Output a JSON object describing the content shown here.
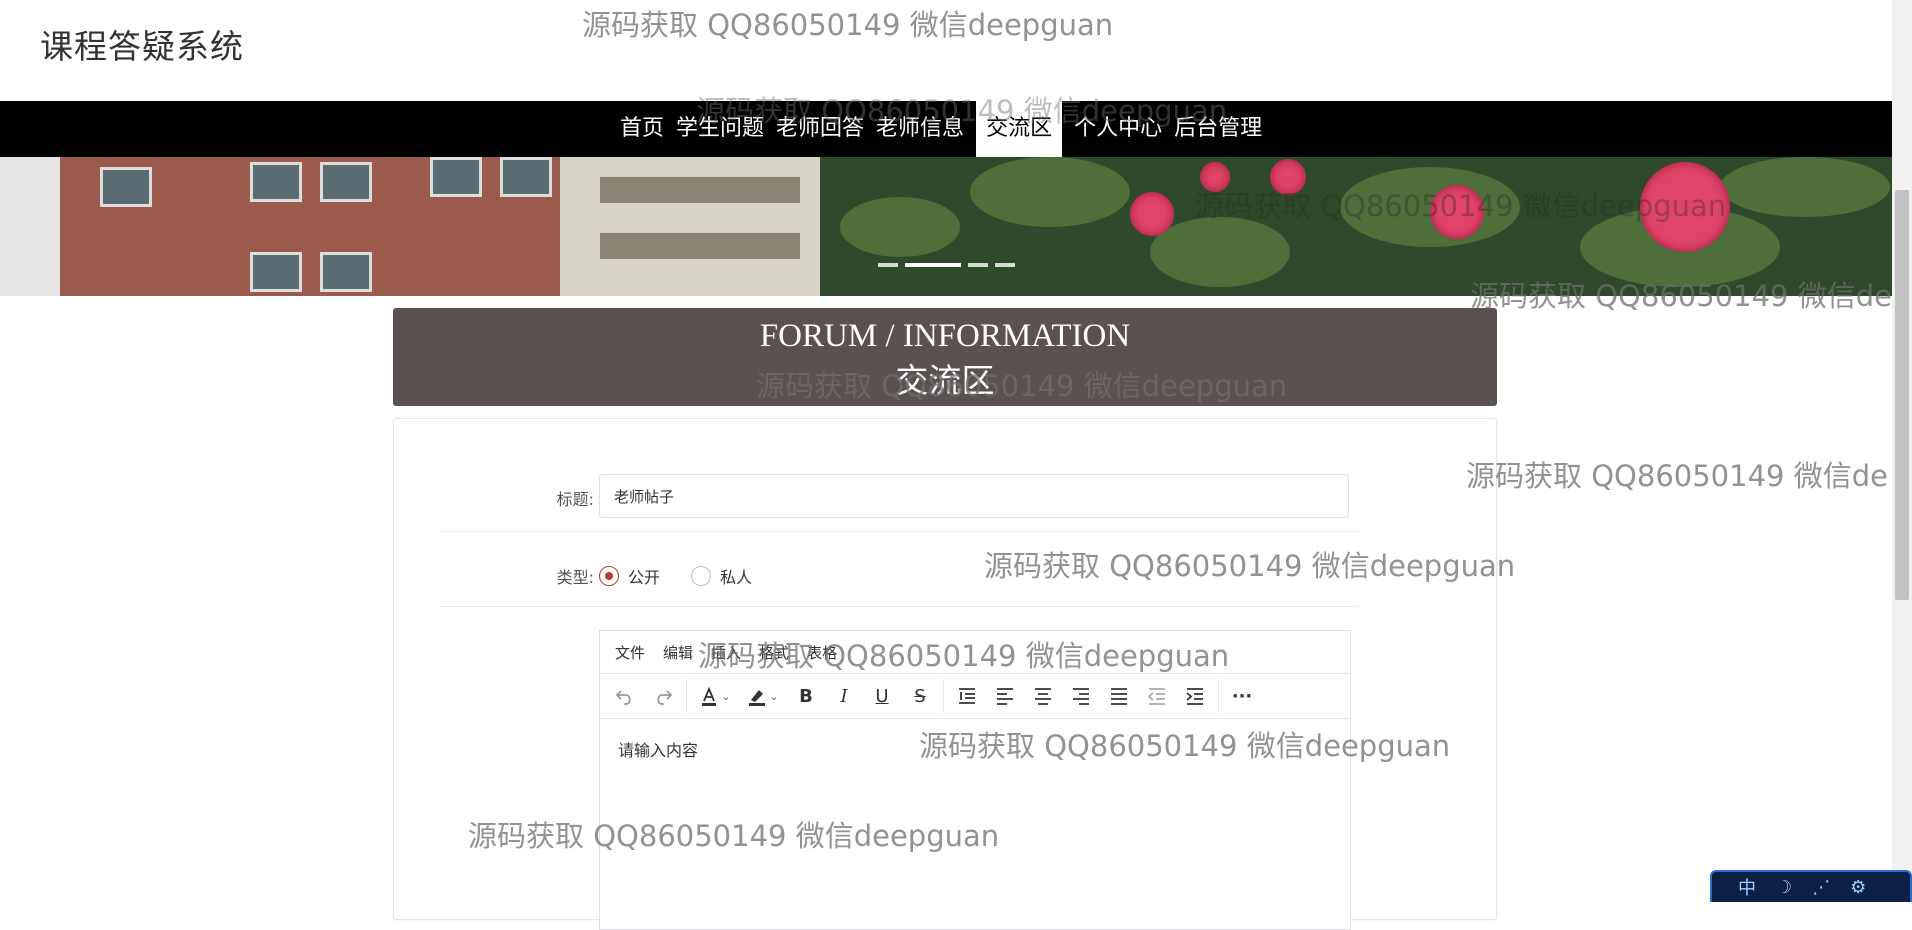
{
  "site": {
    "title": "课程答疑系统"
  },
  "nav": {
    "items": [
      "首页",
      "学生问题",
      "老师回答",
      "老师信息",
      "交流区",
      "个人中心",
      "后台管理"
    ],
    "active_index": 4
  },
  "banner": {
    "slide_count": 4,
    "active_slide": 1
  },
  "header": {
    "en": "FORUM / INFORMATION",
    "zh": "交流区"
  },
  "form": {
    "title_label": "标题:",
    "title_value": "老师帖子",
    "type_label": "类型:",
    "type_options": [
      "公开",
      "私人"
    ],
    "type_selected": "公开",
    "editor": {
      "menus": [
        "文件",
        "编辑",
        "插入",
        "格式",
        "表格"
      ],
      "toolbar_icons": [
        "undo-icon",
        "redo-icon",
        "font-color-icon",
        "highlight-color-icon",
        "bold-icon",
        "italic-icon",
        "underline-icon",
        "strikethrough-icon",
        "line-height-icon",
        "align-left-icon",
        "align-center-icon",
        "align-right-icon",
        "justify-icon",
        "outdent-icon",
        "indent-icon",
        "more-icon"
      ],
      "placeholder": "请输入内容"
    }
  },
  "watermark": {
    "text": "源码获取 QQ86050149 微信deepguan",
    "text_cut1": "源码获取 QQ86050149 微信dee",
    "text_cut2": "源码获取 QQ86050149 微信de"
  },
  "ime": {
    "mode": "中"
  },
  "colors": {
    "nav_bg": "#000000",
    "header_bg": "#5a5150",
    "radio_accent": "#c0392b"
  }
}
